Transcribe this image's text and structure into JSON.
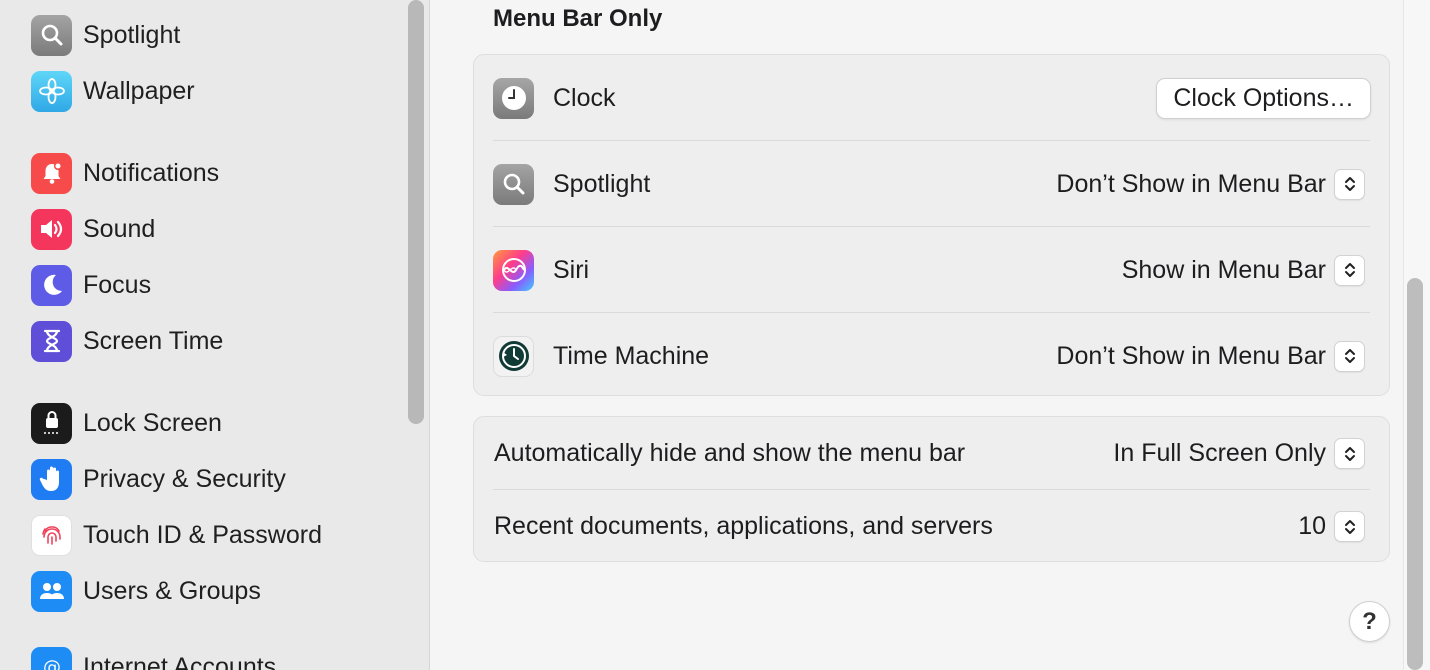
{
  "sidebar": {
    "items": [
      {
        "label": "Spotlight",
        "icon": "spotlight-icon"
      },
      {
        "label": "Wallpaper",
        "icon": "wallpaper-icon"
      },
      {
        "label": "Notifications",
        "icon": "notifications-icon"
      },
      {
        "label": "Sound",
        "icon": "sound-icon"
      },
      {
        "label": "Focus",
        "icon": "focus-icon"
      },
      {
        "label": "Screen Time",
        "icon": "screen-time-icon"
      },
      {
        "label": "Lock Screen",
        "icon": "lock-screen-icon"
      },
      {
        "label": "Privacy & Security",
        "icon": "privacy-icon"
      },
      {
        "label": "Touch ID & Password",
        "icon": "touch-id-icon"
      },
      {
        "label": "Users & Groups",
        "icon": "users-groups-icon"
      },
      {
        "label": "Internet Accounts",
        "icon": "internet-accounts-icon"
      }
    ]
  },
  "main": {
    "section_title": "Menu Bar Only",
    "menu_bar_items": [
      {
        "label": "Clock",
        "icon": "clock-icon",
        "button": "Clock Options…"
      },
      {
        "label": "Spotlight",
        "icon": "spotlight-icon",
        "value": "Don’t Show in Menu Bar"
      },
      {
        "label": "Siri",
        "icon": "siri-icon",
        "value": "Show in Menu Bar"
      },
      {
        "label": "Time Machine",
        "icon": "time-machine-icon",
        "value": "Don’t Show in Menu Bar"
      }
    ],
    "settings": [
      {
        "label": "Automatically hide and show the menu bar",
        "value": "In Full Screen Only"
      },
      {
        "label": "Recent documents, applications, and servers",
        "value": "10"
      }
    ],
    "help_label": "?"
  },
  "colors": {
    "notifications": "#f74b4b",
    "sound": "#f5365c",
    "focus": "#5e5ce6",
    "screen_time": "#5e4ed8",
    "privacy": "#1f7cf2",
    "users": "#1d8cf5",
    "wallpaper": "#3cc5f0"
  }
}
